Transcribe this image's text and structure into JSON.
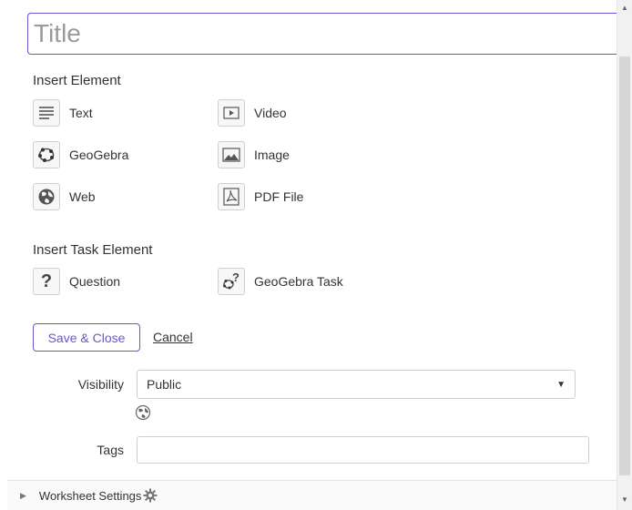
{
  "title_field": {
    "placeholder": "Title"
  },
  "insert_element": {
    "heading": "Insert Element",
    "items": [
      {
        "label": "Text",
        "icon": "text-icon"
      },
      {
        "label": "Video",
        "icon": "video-icon"
      },
      {
        "label": "GeoGebra",
        "icon": "geogebra-icon"
      },
      {
        "label": "Image",
        "icon": "image-icon"
      },
      {
        "label": "Web",
        "icon": "globe-icon"
      },
      {
        "label": "PDF File",
        "icon": "pdf-icon"
      }
    ]
  },
  "insert_task": {
    "heading": "Insert Task Element",
    "items": [
      {
        "label": "Question",
        "icon": "question-icon"
      },
      {
        "label": "GeoGebra Task",
        "icon": "geogebra-task-icon"
      }
    ]
  },
  "actions": {
    "save_label": "Save & Close",
    "cancel_label": "Cancel"
  },
  "visibility": {
    "label": "Visibility",
    "value": "Public"
  },
  "tags": {
    "label": "Tags",
    "value": ""
  },
  "worksheet_settings": {
    "label": "Worksheet Settings"
  },
  "colors": {
    "accent": "#6557d2",
    "border": "#cfcfcf"
  }
}
